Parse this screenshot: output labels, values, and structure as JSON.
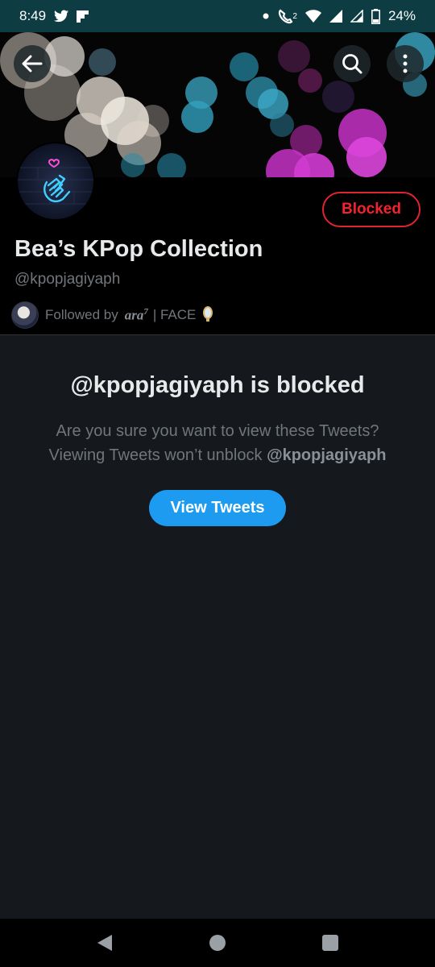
{
  "status_bar": {
    "time": "8:49",
    "battery": "24%",
    "call_badge": "2",
    "icons": [
      "twitter-icon",
      "flipboard-icon",
      "dot-icon",
      "wifi-call-icon",
      "wifi-icon",
      "signal-icon",
      "signal-icon-2",
      "battery-icon"
    ]
  },
  "header": {
    "back_icon": "arrow-left-icon",
    "search_icon": "search-icon",
    "more_icon": "more-vertical-icon"
  },
  "profile": {
    "display_name": "Bea’s KPop Collection",
    "handle": "@kpopjagiyaph",
    "block_button_label": "Blocked",
    "followed_by_prefix": "Followed by",
    "follower_name": "ara",
    "follower_superscript": "7",
    "follower_suffix": "| FACE"
  },
  "blocked_notice": {
    "title": "@kpopjagiyaph is blocked",
    "line1": "Are you sure you want to view these Tweets?",
    "line2_prefix": "Viewing Tweets won’t unblock",
    "line2_handle": "@kpopjagiyaph",
    "button_label": "View Tweets"
  },
  "colors": {
    "background": "#15181c",
    "accent_blue": "#1d9bf0",
    "blocked_red": "#f4212e",
    "status_bar": "#0d3d43"
  }
}
